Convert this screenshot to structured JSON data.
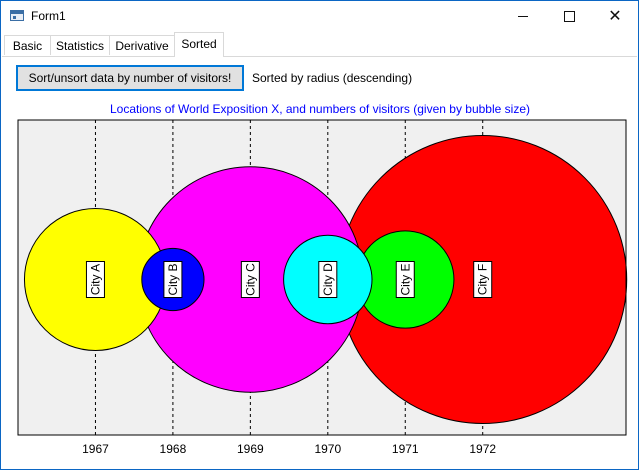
{
  "window": {
    "title": "Form1",
    "controls": {
      "minimize": "–",
      "maximize": "□",
      "close": "✕"
    }
  },
  "tabs": [
    {
      "label": "Basic",
      "active": false
    },
    {
      "label": "Statistics",
      "active": false
    },
    {
      "label": "Derivative",
      "active": false
    },
    {
      "label": "Sorted",
      "active": true
    }
  ],
  "toolbar": {
    "sort_button_label": "Sort/unsort data by number of visitors!",
    "status_text": "Sorted by radius (descending)"
  },
  "chart_data": {
    "type": "bubble",
    "title": "Locations of World Exposition X, and numbers of visitors (given by bubble size)",
    "title_color": "#0000ff",
    "xlabel": "",
    "ylabel": "",
    "xlim": [
      1966,
      1973.85
    ],
    "x_ticks": [
      1967,
      1968,
      1969,
      1970,
      1971,
      1972
    ],
    "grid": "vertical dashed at ticks",
    "plot_background": "#f0f0f0",
    "label_rotation_deg": -90,
    "bubbles": [
      {
        "label": "City F",
        "x": 1972,
        "size": 1.0,
        "color": "#ff0000"
      },
      {
        "label": "City C",
        "x": 1969,
        "size": 0.783,
        "color": "#ff00ff"
      },
      {
        "label": "City A",
        "x": 1967,
        "size": 0.493,
        "color": "#ffff00"
      },
      {
        "label": "City E",
        "x": 1971,
        "size": 0.338,
        "color": "#00ff00"
      },
      {
        "label": "City D",
        "x": 1970,
        "size": 0.307,
        "color": "#00ffff"
      },
      {
        "label": "City B",
        "x": 1968,
        "size": 0.216,
        "color": "#0000ff"
      }
    ]
  }
}
